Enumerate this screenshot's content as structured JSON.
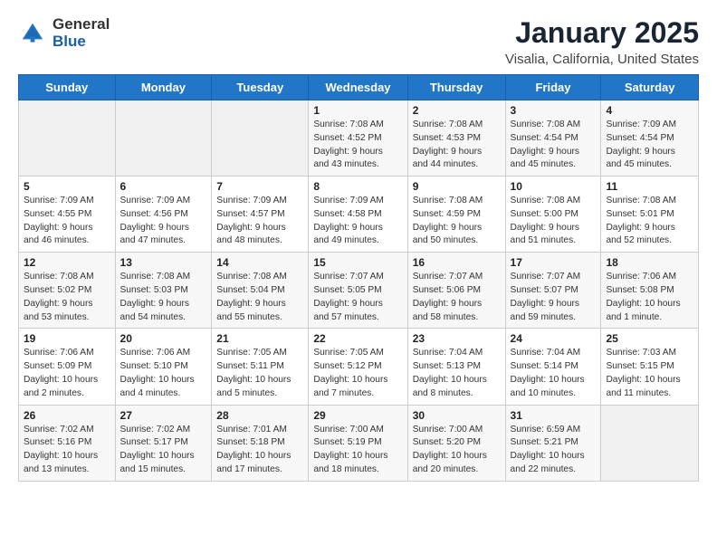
{
  "logo": {
    "general": "General",
    "blue": "Blue"
  },
  "header": {
    "title": "January 2025",
    "subtitle": "Visalia, California, United States"
  },
  "weekdays": [
    "Sunday",
    "Monday",
    "Tuesday",
    "Wednesday",
    "Thursday",
    "Friday",
    "Saturday"
  ],
  "weeks": [
    [
      {
        "day": "",
        "info": ""
      },
      {
        "day": "",
        "info": ""
      },
      {
        "day": "",
        "info": ""
      },
      {
        "day": "1",
        "info": "Sunrise: 7:08 AM\nSunset: 4:52 PM\nDaylight: 9 hours\nand 43 minutes."
      },
      {
        "day": "2",
        "info": "Sunrise: 7:08 AM\nSunset: 4:53 PM\nDaylight: 9 hours\nand 44 minutes."
      },
      {
        "day": "3",
        "info": "Sunrise: 7:08 AM\nSunset: 4:54 PM\nDaylight: 9 hours\nand 45 minutes."
      },
      {
        "day": "4",
        "info": "Sunrise: 7:09 AM\nSunset: 4:54 PM\nDaylight: 9 hours\nand 45 minutes."
      }
    ],
    [
      {
        "day": "5",
        "info": "Sunrise: 7:09 AM\nSunset: 4:55 PM\nDaylight: 9 hours\nand 46 minutes."
      },
      {
        "day": "6",
        "info": "Sunrise: 7:09 AM\nSunset: 4:56 PM\nDaylight: 9 hours\nand 47 minutes."
      },
      {
        "day": "7",
        "info": "Sunrise: 7:09 AM\nSunset: 4:57 PM\nDaylight: 9 hours\nand 48 minutes."
      },
      {
        "day": "8",
        "info": "Sunrise: 7:09 AM\nSunset: 4:58 PM\nDaylight: 9 hours\nand 49 minutes."
      },
      {
        "day": "9",
        "info": "Sunrise: 7:08 AM\nSunset: 4:59 PM\nDaylight: 9 hours\nand 50 minutes."
      },
      {
        "day": "10",
        "info": "Sunrise: 7:08 AM\nSunset: 5:00 PM\nDaylight: 9 hours\nand 51 minutes."
      },
      {
        "day": "11",
        "info": "Sunrise: 7:08 AM\nSunset: 5:01 PM\nDaylight: 9 hours\nand 52 minutes."
      }
    ],
    [
      {
        "day": "12",
        "info": "Sunrise: 7:08 AM\nSunset: 5:02 PM\nDaylight: 9 hours\nand 53 minutes."
      },
      {
        "day": "13",
        "info": "Sunrise: 7:08 AM\nSunset: 5:03 PM\nDaylight: 9 hours\nand 54 minutes."
      },
      {
        "day": "14",
        "info": "Sunrise: 7:08 AM\nSunset: 5:04 PM\nDaylight: 9 hours\nand 55 minutes."
      },
      {
        "day": "15",
        "info": "Sunrise: 7:07 AM\nSunset: 5:05 PM\nDaylight: 9 hours\nand 57 minutes."
      },
      {
        "day": "16",
        "info": "Sunrise: 7:07 AM\nSunset: 5:06 PM\nDaylight: 9 hours\nand 58 minutes."
      },
      {
        "day": "17",
        "info": "Sunrise: 7:07 AM\nSunset: 5:07 PM\nDaylight: 9 hours\nand 59 minutes."
      },
      {
        "day": "18",
        "info": "Sunrise: 7:06 AM\nSunset: 5:08 PM\nDaylight: 10 hours\nand 1 minute."
      }
    ],
    [
      {
        "day": "19",
        "info": "Sunrise: 7:06 AM\nSunset: 5:09 PM\nDaylight: 10 hours\nand 2 minutes."
      },
      {
        "day": "20",
        "info": "Sunrise: 7:06 AM\nSunset: 5:10 PM\nDaylight: 10 hours\nand 4 minutes."
      },
      {
        "day": "21",
        "info": "Sunrise: 7:05 AM\nSunset: 5:11 PM\nDaylight: 10 hours\nand 5 minutes."
      },
      {
        "day": "22",
        "info": "Sunrise: 7:05 AM\nSunset: 5:12 PM\nDaylight: 10 hours\nand 7 minutes."
      },
      {
        "day": "23",
        "info": "Sunrise: 7:04 AM\nSunset: 5:13 PM\nDaylight: 10 hours\nand 8 minutes."
      },
      {
        "day": "24",
        "info": "Sunrise: 7:04 AM\nSunset: 5:14 PM\nDaylight: 10 hours\nand 10 minutes."
      },
      {
        "day": "25",
        "info": "Sunrise: 7:03 AM\nSunset: 5:15 PM\nDaylight: 10 hours\nand 11 minutes."
      }
    ],
    [
      {
        "day": "26",
        "info": "Sunrise: 7:02 AM\nSunset: 5:16 PM\nDaylight: 10 hours\nand 13 minutes."
      },
      {
        "day": "27",
        "info": "Sunrise: 7:02 AM\nSunset: 5:17 PM\nDaylight: 10 hours\nand 15 minutes."
      },
      {
        "day": "28",
        "info": "Sunrise: 7:01 AM\nSunset: 5:18 PM\nDaylight: 10 hours\nand 17 minutes."
      },
      {
        "day": "29",
        "info": "Sunrise: 7:00 AM\nSunset: 5:19 PM\nDaylight: 10 hours\nand 18 minutes."
      },
      {
        "day": "30",
        "info": "Sunrise: 7:00 AM\nSunset: 5:20 PM\nDaylight: 10 hours\nand 20 minutes."
      },
      {
        "day": "31",
        "info": "Sunrise: 6:59 AM\nSunset: 5:21 PM\nDaylight: 10 hours\nand 22 minutes."
      },
      {
        "day": "",
        "info": ""
      }
    ]
  ]
}
